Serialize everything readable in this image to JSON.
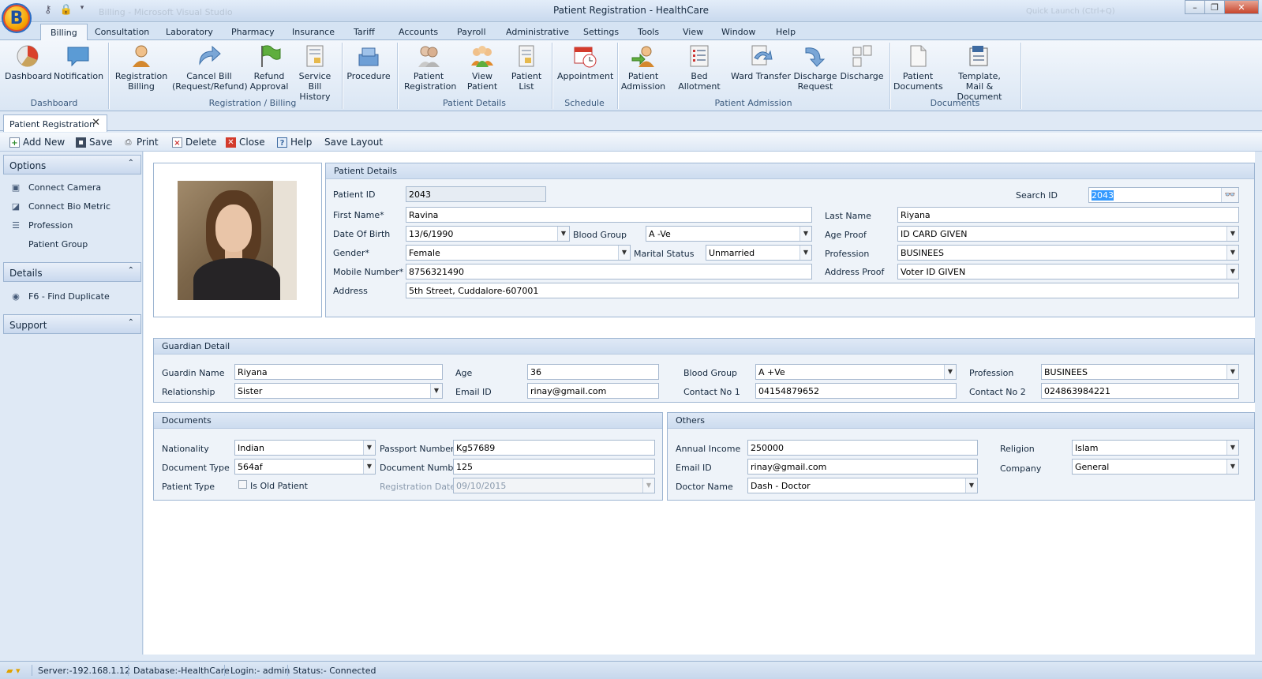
{
  "window": {
    "title": "Patient Registration - HealthCare",
    "orb_letter": "B",
    "faded_title": "Billing - Microsoft Visual Studio",
    "faded_search": "Quick Launch (Ctrl+Q)"
  },
  "menu": [
    "Billing",
    "Consultation",
    "Laboratory",
    "Pharmacy",
    "Insurance",
    "Tariff",
    "Accounts",
    "Payroll",
    "Administrative",
    "Settings",
    "Tools",
    "View",
    "Window",
    "Help"
  ],
  "ribbon": {
    "groups": {
      "dashboard": "Dashboard",
      "registration_billing": "Registration / Billing",
      "patient_details": "Patient Details",
      "schedule": "Schedule",
      "patient_admission": "Patient Admission",
      "documents": "Documents"
    },
    "buttons": {
      "dashboard": [
        "Dashboard"
      ],
      "notification": [
        "Notification"
      ],
      "registration_billing": [
        "Registration",
        "Billing"
      ],
      "cancel_bill": [
        "Cancel Bill",
        "(Request/Refund)"
      ],
      "refund_approval": [
        "Refund",
        "Approval"
      ],
      "service_bill_history": [
        "Service Bill",
        "History"
      ],
      "procedure": [
        "Procedure"
      ],
      "patient_registration": [
        "Patient",
        "Registration"
      ],
      "view_patient": [
        "View Patient"
      ],
      "patient_list": [
        "Patient",
        "List"
      ],
      "appointment": [
        "Appointment"
      ],
      "patient_admission": [
        "Patient",
        "Admission"
      ],
      "bed_allotment": [
        "Bed Allotment"
      ],
      "ward_transfer": [
        "Ward Transfer"
      ],
      "discharge_request": [
        "Discharge",
        "Request"
      ],
      "discharge": [
        "Discharge"
      ],
      "patient_documents": [
        "Patient",
        "Documents"
      ],
      "template_mail": [
        "Template,",
        "Mail & Document"
      ]
    }
  },
  "doc_tab": {
    "label": "Patient Registration",
    "close": "✕"
  },
  "toolbar": {
    "add_new": "Add New",
    "save": "Save",
    "print": "Print",
    "delete": "Delete",
    "close": "Close",
    "help": "Help",
    "save_layout": "Save Layout"
  },
  "left_panel": {
    "options": {
      "title": "Options",
      "items": [
        "Connect Camera",
        "Connect Bio Metric",
        "Profession",
        "Patient Group"
      ]
    },
    "details": {
      "title": "Details",
      "items": [
        "F6 - Find Duplicate"
      ]
    },
    "support": {
      "title": "Support"
    }
  },
  "patient_details": {
    "title": "Patient Details",
    "labels": {
      "patient_id": "Patient ID",
      "search_id": "Search ID",
      "first_name": "First Name*",
      "last_name": "Last Name",
      "dob": "Date Of Birth",
      "blood_group": "Blood Group",
      "age_proof": "Age Proof",
      "gender": "Gender*",
      "marital_status": "Marital Status",
      "profession": "Profession",
      "mobile": "Mobile Number*",
      "address_proof": "Address Proof",
      "address": "Address"
    },
    "values": {
      "patient_id": "2043",
      "search_id": "2043",
      "first_name": "Ravina",
      "last_name": "Riyana",
      "dob": "13/6/1990",
      "blood_group": "A -Ve",
      "age_proof": "ID CARD GIVEN",
      "gender": "Female",
      "marital_status": "Unmarried",
      "profession": "BUSINEES",
      "mobile": "8756321490",
      "address_proof": "Voter ID GIVEN",
      "address": "5th Street, Cuddalore-607001"
    }
  },
  "guardian": {
    "title": "Guardian Detail",
    "labels": {
      "name": "Guardin Name",
      "age": "Age",
      "blood_group": "Blood Group",
      "profession": "Profession",
      "relationship": "Relationship",
      "email": "Email ID",
      "contact1": "Contact No 1",
      "contact2": "Contact No 2"
    },
    "values": {
      "name": "Riyana",
      "age": "36",
      "blood_group": "A +Ve",
      "profession": "BUSINEES",
      "relationship": "Sister",
      "email": "rinay@gmail.com",
      "contact1": "04154879652",
      "contact2": "024863984221"
    }
  },
  "documents": {
    "title": "Documents",
    "labels": {
      "nationality": "Nationality",
      "passport": "Passport Number",
      "doc_type": "Document Type",
      "doc_number": "Document Number",
      "patient_type": "Patient Type",
      "is_old": "Is Old Patient",
      "reg_date": "Registration Date"
    },
    "values": {
      "nationality": "Indian",
      "passport": "Kg57689",
      "doc_type": "564af",
      "doc_number": "125",
      "reg_date": "09/10/2015",
      "is_old_checked": false
    }
  },
  "others": {
    "title": "Others",
    "labels": {
      "income": "Annual Income",
      "religion": "Religion",
      "email": "Email ID",
      "company": "Company",
      "doctor": "Doctor Name"
    },
    "values": {
      "income": "250000",
      "religion": "Islam",
      "email": "rinay@gmail.com",
      "company": "General",
      "doctor": "Dash - Doctor"
    }
  },
  "status_bar": {
    "server": "Server:-192.168.1.12",
    "database": "Database:-HealthCare",
    "login": "Login:- admin",
    "status": "Status:- Connected"
  },
  "colors": {
    "frame": "#dfe9f5",
    "border": "#9db5d2",
    "text": "#15293f",
    "selection": "#3399ff"
  }
}
